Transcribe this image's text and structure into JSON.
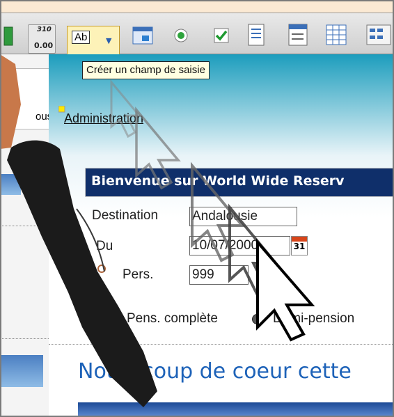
{
  "toolbar": {
    "counter_top": "310",
    "counter_value": "0.00",
    "text_field_button_label": "Ab",
    "tooltip": "Créer un champ de saisie"
  },
  "left_panel": {
    "link_fragment": "ous"
  },
  "page": {
    "admin_link": "Administration",
    "banner": "Bienvenue sur World Wide Reserv",
    "destination_label": "Destination",
    "destination_value": "Andalousie",
    "du_label": "Du",
    "date_value": "10/07/2000",
    "calendar_day": "31",
    "pers_label": "Pers.",
    "pers_value": "999",
    "pension_complete": "Pens. complète",
    "demi_pension": "Demi-pension",
    "heading": "Notre coup de coeur cette"
  }
}
